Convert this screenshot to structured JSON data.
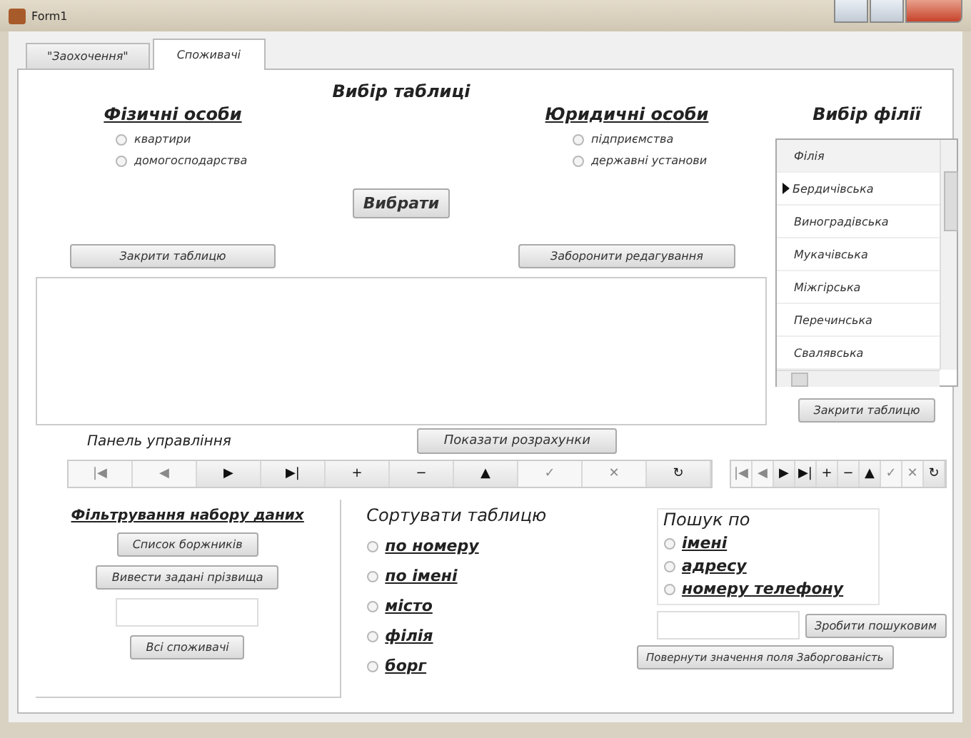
{
  "window": {
    "title": "Form1"
  },
  "tabs": [
    {
      "label": "\"Заохочення\"",
      "selected": false
    },
    {
      "label": "Споживачі",
      "selected": true
    }
  ],
  "table_choice": {
    "title": "Вибір таблиці",
    "button": "Вибрати",
    "groups": [
      {
        "title": "Фізичні особи",
        "options": [
          {
            "label": "квартири",
            "checked": false
          },
          {
            "label": "домогосподарства",
            "checked": false
          }
        ],
        "button": "Закрити таблицю"
      },
      {
        "title": "Юридичні особи",
        "options": [
          {
            "label": "підприємства",
            "checked": false
          },
          {
            "label": "державні установи",
            "checked": false
          }
        ],
        "button": "Заборонити редагування"
      }
    ]
  },
  "branches": {
    "title": "Вибір філії",
    "header": "Філія",
    "rows": [
      {
        "name": "Бердичівська",
        "selected": true
      },
      {
        "name": "Виноградівська",
        "selected": false
      },
      {
        "name": "Мукачівська",
        "selected": false
      },
      {
        "name": "Міжгірська",
        "selected": false
      },
      {
        "name": "Перечинська",
        "selected": false
      },
      {
        "name": "Свалявська",
        "selected": false
      }
    ],
    "button": "Закрити таблицю"
  },
  "control_panel": {
    "title": "Панель управління",
    "button": "Показати розрахунки"
  },
  "navigators": [
    {
      "buttons": [
        {
          "glyph": "|◀",
          "disabled": true
        },
        {
          "glyph": "◀",
          "disabled": true
        },
        {
          "glyph": "▶",
          "disabled": false
        },
        {
          "glyph": "▶|",
          "disabled": false
        },
        {
          "glyph": "+",
          "disabled": false
        },
        {
          "glyph": "−",
          "disabled": false
        },
        {
          "glyph": "▲",
          "disabled": false
        },
        {
          "glyph": "✓",
          "disabled": true
        },
        {
          "glyph": "✕",
          "disabled": true
        },
        {
          "glyph": "↻",
          "disabled": false
        }
      ]
    },
    {
      "buttons": [
        {
          "glyph": "|◀",
          "disabled": true
        },
        {
          "glyph": "◀",
          "disabled": true
        },
        {
          "glyph": "▶",
          "disabled": false
        },
        {
          "glyph": "▶|",
          "disabled": false
        },
        {
          "glyph": "+",
          "disabled": false
        },
        {
          "glyph": "−",
          "disabled": false
        },
        {
          "glyph": "▲",
          "disabled": false
        },
        {
          "glyph": "✓",
          "disabled": true
        },
        {
          "glyph": "✕",
          "disabled": true
        },
        {
          "glyph": "↻",
          "disabled": false
        }
      ]
    }
  ],
  "filter": {
    "title": "Фільтрування набору даних",
    "buttons": [
      "Список боржників",
      "Вивести задані прізвища",
      "Всі споживачі"
    ]
  },
  "sort": {
    "title": "Сортувати таблицю",
    "options": [
      {
        "label": "по номеру",
        "checked": false
      },
      {
        "label": "по імені",
        "checked": false
      },
      {
        "label": "місто",
        "checked": false
      },
      {
        "label": "філія",
        "checked": false
      },
      {
        "label": "борг",
        "checked": false
      }
    ]
  },
  "search": {
    "title": "Пошук по",
    "options": [
      {
        "label": "імені",
        "checked": false
      },
      {
        "label": "адресу",
        "checked": false
      },
      {
        "label": "номеру телефону",
        "checked": false
      }
    ],
    "button": "Зробити пошуковим",
    "restore_button": "Повернути значення поля Заборгованість"
  }
}
